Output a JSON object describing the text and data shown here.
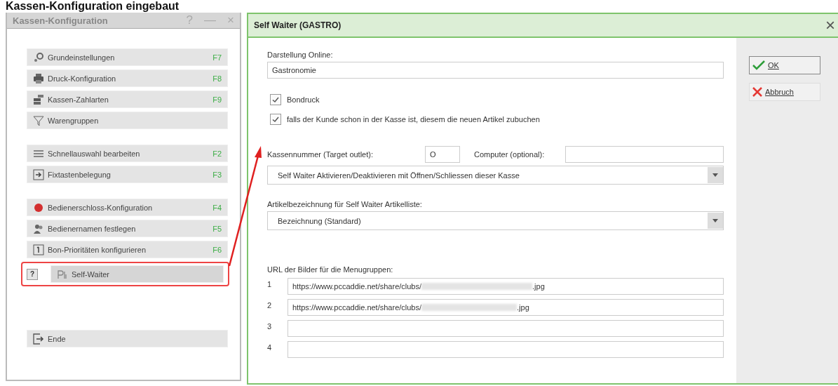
{
  "page_heading": "Kassen-Konfiguration eingebaut",
  "left_window": {
    "title": "Kassen-Konfiguration",
    "controls": [
      "?",
      "—",
      "×"
    ],
    "groups": [
      [
        {
          "kind": "item",
          "label": "Grundeinstellungen",
          "key": "F7"
        },
        {
          "kind": "item",
          "label": "Druck-Konfiguration",
          "key": "F8"
        },
        {
          "kind": "item",
          "label": "Kassen-Zahlarten",
          "key": "F9"
        },
        {
          "kind": "item",
          "label": "Warengruppen"
        }
      ],
      [
        {
          "kind": "item",
          "label": "Schnellauswahl bearbeiten",
          "key": "F2"
        },
        {
          "kind": "item",
          "label": "Fixtastenbelegung",
          "key": "F3"
        }
      ],
      [
        {
          "kind": "item",
          "label": "Bedienerschloss-Konfiguration",
          "key": "F4"
        },
        {
          "kind": "item",
          "label": "Bedienernamen festlegen",
          "key": "F5"
        },
        {
          "kind": "item",
          "label": "Bon-Prioritäten konfigurieren",
          "key": "F6"
        },
        {
          "kind": "help",
          "help": "?",
          "label": "Self-Waiter",
          "highlighted": true
        }
      ],
      [
        {
          "kind": "item",
          "label": "Ende"
        }
      ]
    ]
  },
  "dialog": {
    "title": "Self Waiter (GASTRO)",
    "close": "×",
    "online_label": "Darstellung Online:",
    "online_value": "Gastronomie",
    "checkboxes": [
      {
        "label": "Bondruck",
        "checked": true
      },
      {
        "label": "falls der Kunde schon in der Kasse ist, diesem die neuen Artikel zubuchen",
        "checked": true
      }
    ],
    "register_label": "Kassennummer (Target outlet):",
    "register_value": "O",
    "computer_label": "Computer (optional):",
    "mode_select": "Self Waiter Aktivieren/Deaktivieren mit Öffnen/Schliessen dieser Kasse",
    "article_label": "Artikelbezeichnung für Self Waiter Artikelliste:",
    "article_select": "Bezeichnung (Standard)",
    "url_label": "URL der Bilder für die Menugruppen:",
    "urls": [
      {
        "number": "1",
        "prefix": "https://www.pccaddie.net/share/clubs/",
        "suffix": ".jpg",
        "redacted": true
      },
      {
        "number": "2",
        "prefix": "https://www.pccaddie.net/share/clubs/",
        "suffix": ".jpg",
        "redacted": true
      },
      {
        "number": "3"
      },
      {
        "number": "4"
      }
    ],
    "buttons": [
      {
        "kind": "ok",
        "label": "OK"
      },
      {
        "kind": "cancel",
        "label": "Abbruch"
      }
    ]
  },
  "annotation": {
    "arrow": true
  }
}
